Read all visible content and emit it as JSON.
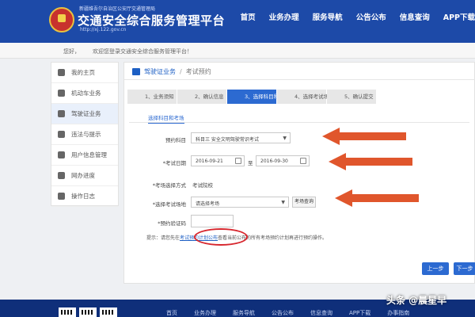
{
  "header": {
    "sub_text": "新疆维吾尔自治区公安厅交通管理局",
    "title": "交通安全综合服务管理平台",
    "url": "http://xj.122.gov.cn",
    "nav": [
      "首页",
      "业务办理",
      "服务导航",
      "公告公布",
      "信息查询",
      "APP下载"
    ]
  },
  "welcome": {
    "greeting": "您好，",
    "message": "欢迎您登录交通安全综合服务管理平台！"
  },
  "sidebar": {
    "items": [
      {
        "label": "我的主页",
        "icon": "home-icon"
      },
      {
        "label": "机动车业务",
        "icon": "car-icon"
      },
      {
        "label": "驾驶证业务",
        "icon": "license-icon"
      },
      {
        "label": "违法与提示",
        "icon": "bell-icon"
      },
      {
        "label": "用户信息管理",
        "icon": "user-icon"
      },
      {
        "label": "网办进度",
        "icon": "monitor-icon"
      },
      {
        "label": "操作日志",
        "icon": "log-icon"
      }
    ]
  },
  "breadcrumb": {
    "section": "驾驶证业务",
    "current": "考试预约"
  },
  "steps": [
    "1、业务须知",
    "2、确认信息",
    "3、选择科目和考场",
    "4、选择考试场次",
    "5、确认提交"
  ],
  "subtab": "选择科目和考场",
  "form": {
    "subject_label": "预约科目",
    "subject_value": "科目三 安全文明驾驶常识考试",
    "date_label": "*考试日期",
    "date_start": "2016-09-21",
    "date_sep": "至",
    "date_end": "2016-09-30",
    "method_label": "*考场选择方式",
    "method_value": "考试院校",
    "site_label": "*选择考试场地",
    "site_value": "请选择考场",
    "site_button": "考场查询",
    "code_label": "*预约验证码",
    "code_value": ""
  },
  "tip": {
    "prefix": "提示：请您先在",
    "link": "考试预约计划公布",
    "suffix": "查看当前公布的所有考场预约计划再进行预约操作。"
  },
  "buttons": {
    "prev": "上一步",
    "next": "下一步"
  },
  "footer": {
    "nav": [
      "首页",
      "业务办理",
      "服务导航",
      "公告公布",
      "信息查询",
      "APP下载",
      "办事指南"
    ]
  },
  "watermark": "头条 @晨星早",
  "colors": {
    "header": "#1d4aa8",
    "accent": "#2c6ad1",
    "arrow": "#e0562c",
    "annotation": "#d7262d"
  }
}
